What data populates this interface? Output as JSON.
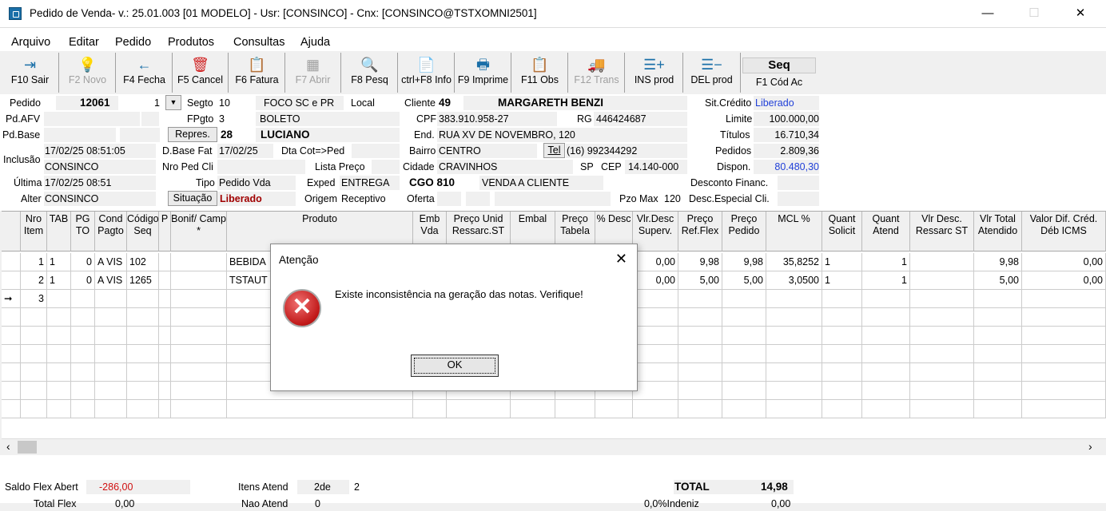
{
  "window": {
    "title": "Pedido de Venda- v.: 25.01.003  [01 MODELO] - Usr: [CONSINCO] - Cnx: [CONSINCO@TSTXOMNI2501]",
    "minimize": "—",
    "maximize": "☐",
    "close": "✕"
  },
  "menu": [
    "Arquivo",
    "Editar",
    "Pedido",
    "Produtos",
    "Consultas",
    "Ajuda"
  ],
  "toolbar": [
    {
      "label": "F10 Sair",
      "icon": "exit-icon",
      "glyph": "⇥",
      "enabled": true
    },
    {
      "label": "F2 Novo",
      "icon": "lightbulb-icon",
      "glyph": "💡",
      "enabled": false
    },
    {
      "label": "F4 Fecha",
      "icon": "arrow-left-icon",
      "glyph": "←",
      "enabled": true
    },
    {
      "label": "F5 Cancel",
      "icon": "trash-icon",
      "glyph": "🗑",
      "enabled": true
    },
    {
      "label": "F6 Fatura",
      "icon": "clipboard-icon",
      "glyph": "📋",
      "enabled": true
    },
    {
      "label": "F7 Abrir",
      "icon": "table-icon",
      "glyph": "▦",
      "enabled": false
    },
    {
      "label": "F8 Pesq",
      "icon": "search-icon",
      "glyph": "🔍",
      "enabled": true
    },
    {
      "label": "ctrl+F8 Info",
      "icon": "document-icon",
      "glyph": "📄",
      "enabled": true
    },
    {
      "label": "F9 Imprime",
      "icon": "printer-icon",
      "glyph": "🖶",
      "enabled": true
    },
    {
      "label": "F11 Obs",
      "icon": "clipboard-icon",
      "glyph": "📋",
      "enabled": true
    },
    {
      "label": "F12 Trans",
      "icon": "truck-icon",
      "glyph": "🚚",
      "enabled": false
    },
    {
      "label": "INS prod",
      "icon": "add-item-icon",
      "glyph": "☰+",
      "enabled": true
    },
    {
      "label": "DEL prod",
      "icon": "remove-item-icon",
      "glyph": "☰−",
      "enabled": true
    }
  ],
  "seq": {
    "title": "Seq",
    "label": "F1 Cód Ac"
  },
  "header": {
    "pedido_lbl": "Pedido",
    "pedido": "12061",
    "pedido_seq": "1",
    "segto_lbl": "Segto",
    "segto": "10",
    "segto_desc": "FOCO SC e PR",
    "local_lbl": "Local",
    "cliente_lbl": "Cliente",
    "cliente_cod": "49",
    "cliente_nome": "MARGARETH BENZI",
    "sitcredito_lbl": "Sit.Crédito",
    "sitcredito": "Liberado",
    "pdafv_lbl": "Pd.AFV",
    "fpgto_lbl": "FPgto",
    "fpgto": "3",
    "fpgto_desc": "BOLETO",
    "cpf_lbl": "CPF",
    "cpf": "383.910.958-27",
    "rg_lbl": "RG",
    "rg": "446424687",
    "limite_lbl": "Limite",
    "limite": "100.000,00",
    "pdbase_lbl": "Pd.Base",
    "repres_btn": "Repres.",
    "repres_cod": "28",
    "repres_nome": "LUCIANO",
    "end_lbl": "End.",
    "end": "RUA XV DE NOVEMBRO, 120",
    "titulos_lbl": "Títulos",
    "titulos": "16.710,34",
    "inclusao_lbl": "Inclusão",
    "inclusao_data": "17/02/25 08:51:05",
    "inclusao_user": "CONSINCO",
    "dbasefat_lbl": "D.Base Fat",
    "dbasefat": "17/02/25",
    "dtacot_lbl": "Dta Cot=>Ped",
    "bairro_lbl": "Bairro",
    "bairro": "CENTRO",
    "tel_btn": "Tel",
    "tel": "(16) 992344292",
    "pedidos_lbl": "Pedidos",
    "pedidos": "2.809,36",
    "nropedcli_lbl": "Nro Ped Cli",
    "listapreco_lbl": "Lista Preço",
    "cidade_lbl": "Cidade",
    "cidade": "CRAVINHOS",
    "uf": "SP",
    "cep_lbl": "CEP",
    "cep": "14.140-000",
    "dispon_lbl": "Dispon.",
    "dispon": "80.480,30",
    "ultima_lbl": "Última",
    "ultima_data": "17/02/25 08:51",
    "tipo_lbl": "Tipo",
    "tipo": "Pedido Vda",
    "exped_lbl": "Exped",
    "exped": "ENTREGA",
    "cgo": "CGO 810",
    "cgo_desc": "VENDA A CLIENTE",
    "descfin_lbl": "Desconto Financ.",
    "alter_lbl": "Alter",
    "alter_user": "CONSINCO",
    "situacao_btn": "Situação",
    "situacao": "Liberado",
    "origem_lbl": "Origem",
    "origem": "Receptivo",
    "oferta_lbl": "Oferta",
    "pzomax_lbl": "Pzo Max",
    "pzomax": "120",
    "descesp_lbl": "Desc.Especial Cli."
  },
  "grid": {
    "columns": [
      "Nro Item",
      "TAB",
      "PG TO",
      "Cond Pagto",
      "Código Seq",
      "P",
      "Bonif/ Camp *",
      "Produto",
      "Emb Vda",
      "Preço Unid Ressarc.ST",
      "Embal",
      "Preço Tabela",
      "% Desc",
      "Vlr.Desc Superv.",
      "Preço Ref.Flex",
      "Preço Pedido",
      "MCL %",
      "Quant Solicit",
      "Quant Atend",
      "Vlr Desc. Ressarc ST",
      "Vlr Total Atendido",
      "Valor Dif. Créd. Déb ICMS"
    ],
    "rows": [
      {
        "item": "1",
        "tab": "1",
        "pg": "0",
        "cond": "A VIS",
        "cod": "102",
        "produto": "BEBIDA",
        "vlrdesc": "0,00",
        "ref": "9,98",
        "preco": "9,98",
        "mcl": "35,8252",
        "qsol": "1",
        "qatend": "1",
        "total": "9,98",
        "dif": "0,00"
      },
      {
        "item": "2",
        "tab": "1",
        "pg": "0",
        "cond": "A VIS",
        "cod": "1265",
        "produto": "TSTAUT",
        "vlrdesc": "0,00",
        "ref": "5,00",
        "preco": "5,00",
        "mcl": "3,0500",
        "qsol": "1",
        "qatend": "1",
        "total": "5,00",
        "dif": "0,00"
      },
      {
        "item": "3"
      }
    ],
    "current_row_marker": "➞"
  },
  "footer": {
    "saldo_lbl": "Saldo Flex Abert",
    "saldo": "-286,00",
    "total_flex_lbl": "Total Flex",
    "total_flex": "0,00",
    "itens_lbl": "Itens Atend",
    "itens": "2de",
    "itens_total": "2",
    "nao_atend_lbl": "Nao Atend",
    "nao_atend": "0",
    "total_lbl": "TOTAL",
    "total": "14,98",
    "indeniz_lbl": "0,0%Indeniz",
    "indeniz": "0,00"
  },
  "dialog": {
    "title": "Atenção",
    "message": "Existe inconsistência na geração das notas. Verifique!",
    "ok": "OK",
    "close": "✕",
    "icon_glyph": "✕"
  },
  "colors": {
    "accent": "#1a6fa8",
    "red_value": "#d01010",
    "blue_value": "#1f3fd8",
    "dark_red": "#a00000"
  }
}
